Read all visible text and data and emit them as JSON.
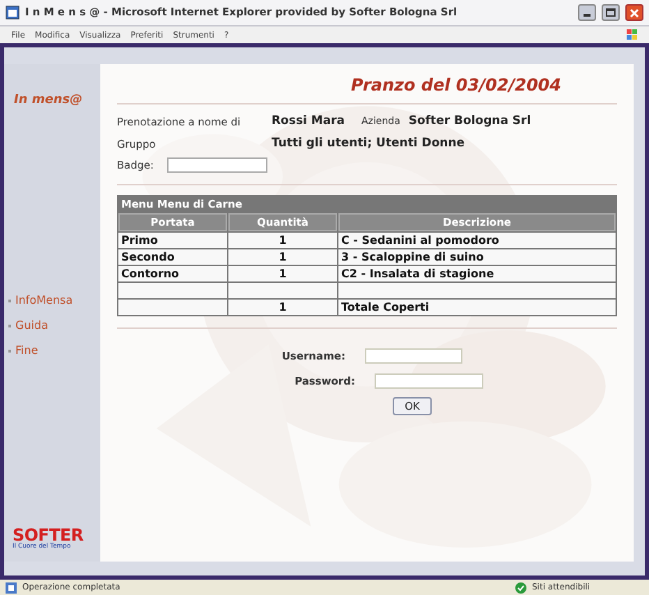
{
  "window": {
    "title": "I n M e n s @ - Microsoft Internet Explorer provided by Softer Bologna Srl"
  },
  "menu_bar": [
    "File",
    "Modifica",
    "Visualizza",
    "Preferiti",
    "Strumenti",
    "?"
  ],
  "sidebar": {
    "logo": "In mens@",
    "items": [
      {
        "label": "InfoMensa"
      },
      {
        "label": "Guida"
      },
      {
        "label": "Fine"
      }
    ],
    "brand": "SOFTER",
    "tagline": "Il Cuore del Tempo"
  },
  "page": {
    "title": "Pranzo del 03/02/2004",
    "info": [
      {
        "label": "Prenotazione a nome di",
        "value": "Rossi Mara",
        "extra_label": "Azienda",
        "extra_value": "Softer Bologna Srl"
      },
      {
        "label": "Gruppo",
        "value": "Tutti gli utenti; Utenti Donne"
      }
    ],
    "badge": {
      "label": "Badge:"
    },
    "table": {
      "title": "Menu Menu di Carne",
      "columns": [
        "Portata",
        "Quantità",
        "Descrizione"
      ],
      "rows": [
        [
          "Primo",
          "1",
          "C - Sedanini al pomodoro"
        ],
        [
          "Secondo",
          "1",
          "3 - Scaloppine di suino"
        ],
        [
          "Contorno",
          "1",
          "C2 - Insalata di stagione"
        ],
        [
          "",
          "",
          ""
        ],
        [
          "",
          "1",
          "Totale Coperti"
        ]
      ]
    },
    "login": {
      "username_label": "Username:",
      "password_label": "Password:",
      "button": "OK"
    }
  },
  "status_bar": {
    "text": "Operazione completata",
    "zone": "Siti attendibili"
  }
}
